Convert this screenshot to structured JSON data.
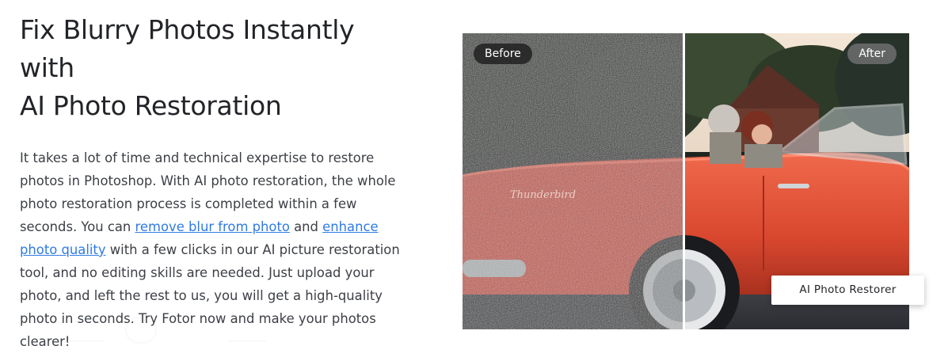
{
  "hero": {
    "title_line1": "Fix Blurry Photos Instantly with",
    "title_line2": "AI Photo Restoration",
    "paragraph": {
      "part1": "It takes a lot of time and technical expertise to restore photos in Photoshop. With AI photo restoration, the whole photo restoration process is completed within a few seconds. You can ",
      "link1": "remove blur from photo",
      "part2": " and ",
      "link2": "enhance photo quality",
      "part3": " with a few clicks in our AI picture restoration tool, and no editing skills are needed. Just upload your photo, and left the rest to us, you will get a high-quality photo in seconds. Try Fotor now and make your photos clearer!"
    }
  },
  "comparison": {
    "before_label": "Before",
    "after_label": "After",
    "car_script": "Thunderbird"
  },
  "cta": {
    "label": "AI Photo Restorer"
  },
  "colors": {
    "link": "#2f7be3",
    "text": "#3c3f45",
    "title": "#222428",
    "car_red": "#e0523a"
  }
}
